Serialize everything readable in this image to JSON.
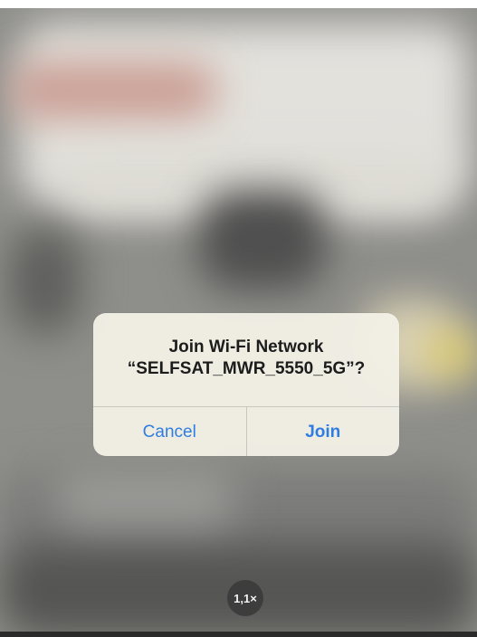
{
  "alert": {
    "title": "Join Wi-Fi Network",
    "message": "“SELFSAT_MWR_5550_5G”?",
    "cancel_label": "Cancel",
    "join_label": "Join"
  },
  "camera": {
    "zoom_label": "1,1×"
  },
  "colors": {
    "accent": "#2f7de1",
    "alert_background": "#f3f0e6"
  }
}
